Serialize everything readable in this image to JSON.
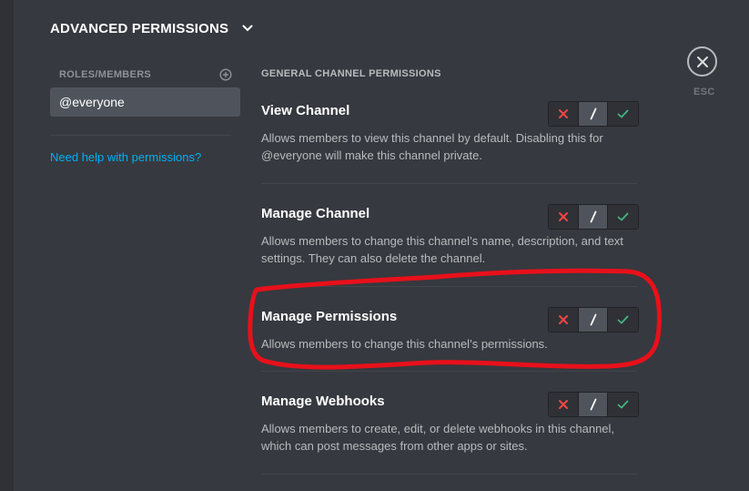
{
  "header": {
    "title": "ADVANCED PERMISSIONS",
    "icon": "chevron-down-icon"
  },
  "roles": {
    "header_label": "ROLES/MEMBERS",
    "add_icon": "add-circle-icon",
    "items": [
      {
        "label": "@everyone",
        "selected": true
      }
    ],
    "help_link": "Need help with permissions?"
  },
  "permissions": {
    "section_title": "GENERAL CHANNEL PERMISSIONS",
    "items": [
      {
        "name": "View Channel",
        "description": "Allows members to view this channel by default. Disabling this for @everyone will make this channel private.",
        "state": "passthrough"
      },
      {
        "name": "Manage Channel",
        "description": "Allows members to change this channel’s name, description, and text settings. They can also delete the channel.",
        "state": "passthrough"
      },
      {
        "name": "Manage Permissions",
        "description": "Allows members to change this channel’s permissions.",
        "state": "passthrough"
      },
      {
        "name": "Manage Webhooks",
        "description": "Allows members to create, edit, or delete webhooks in this channel, which can post messages from other apps or sites.",
        "state": "passthrough"
      }
    ],
    "toggle_icons": {
      "deny": "x-icon",
      "passthrough": "slash-icon",
      "allow": "check-icon"
    }
  },
  "close": {
    "label": "ESC",
    "icon": "close-icon"
  },
  "annotation": {
    "color": "#e8101a",
    "target": "Manage Permissions"
  },
  "colors": {
    "background": "#36393f",
    "deny": "#f04747",
    "allow": "#43b581",
    "link": "#00b0f4"
  }
}
